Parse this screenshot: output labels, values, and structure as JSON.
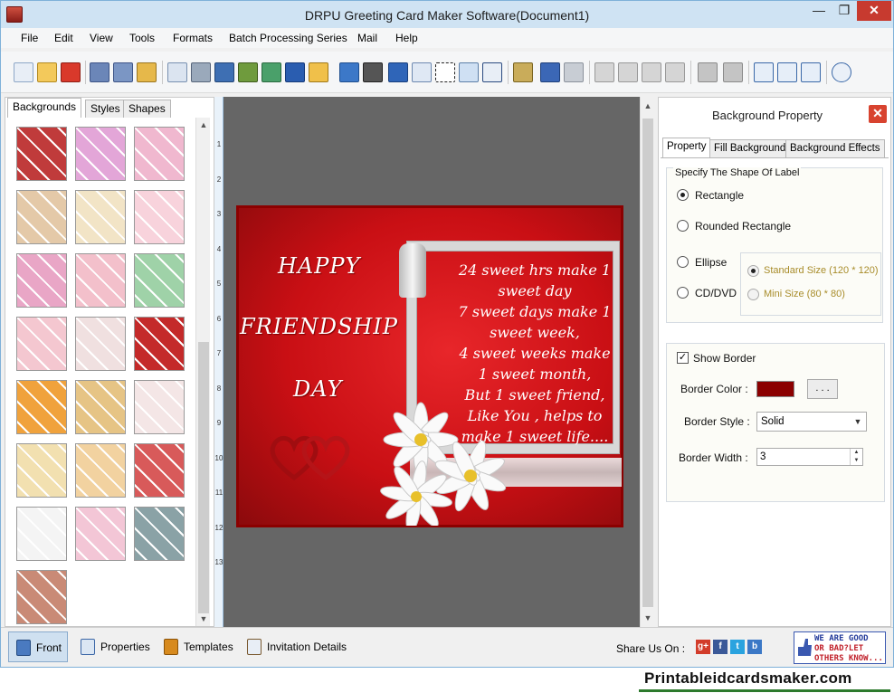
{
  "window": {
    "title": "DRPU Greeting Card Maker Software(Document1)",
    "min": "—",
    "max": "❐",
    "close": "✕"
  },
  "menu": [
    "File",
    "Edit",
    "View",
    "Tools",
    "Formats",
    "Batch Processing Series",
    "Mail",
    "Help"
  ],
  "left_tabs": [
    "Backgrounds",
    "Styles",
    "Shapes"
  ],
  "thumb_colors": [
    "#c03b3b",
    "#e3a6d8",
    "#f0b8cf",
    "#e4c9a8",
    "#f2e4c6",
    "#f8d3dc",
    "#e9a6c6",
    "#f3c0cb",
    "#9fd2a8",
    "#f4c7d0",
    "#f0e0e0",
    "#c42a2a",
    "#f0a23c",
    "#e6c485",
    "#f4e6e6",
    "#f2e0b0",
    "#f2d2a0",
    "#d85a5a",
    "#f4f4f4",
    "#f3c6d6",
    "#8aa2a6",
    "#c98a76"
  ],
  "ruler_numbers": [
    "1",
    "2",
    "3",
    "4",
    "5",
    "6",
    "7",
    "8",
    "9",
    "10",
    "11",
    "12",
    "13"
  ],
  "card": {
    "title_lines": [
      "HAPPY",
      "FRIENDSHIP",
      "DAY"
    ],
    "poem_lines": [
      "24 sweet hrs make 1",
      "sweet day",
      "7 sweet days make 1",
      "sweet week,",
      "4 sweet weeks make",
      "1 sweet month,",
      "But 1 sweet friend,",
      "Like You , helps to",
      "make 1 sweet life...."
    ],
    "background_color": "#d11418",
    "border_color": "#8b0000"
  },
  "panel": {
    "title": "Background Property",
    "tabs": [
      "Property",
      "Fill Background",
      "Background Effects"
    ],
    "shape_group_label": "Specify The Shape Of Label",
    "shapes": [
      "Rectangle",
      "Rounded Rectangle",
      "Ellipse",
      "CD/DVD"
    ],
    "selected_shape": "Rectangle",
    "sizes": [
      "Standard Size (120 * 120)",
      "Mini Size (80 * 80)"
    ],
    "show_border_label": "Show Border",
    "show_border_checked": "✓",
    "border_color_label": "Border Color :",
    "border_color": "#8b0000",
    "dots_label": ". . .",
    "border_style_label": "Border Style :",
    "border_style": "Solid",
    "border_width_label": "Border Width :",
    "border_width": "3"
  },
  "bottom_tabs": [
    "Front",
    "Properties",
    "Templates",
    "Invitation Details"
  ],
  "share_label": "Share Us On :",
  "share_icons": [
    "g+",
    "f",
    "t",
    "b"
  ],
  "feedback_lines": [
    "WE ARE GOOD",
    "OR BAD?LET",
    "OTHERS KNOW..."
  ],
  "footer": "Printableidcardsmaker.com"
}
